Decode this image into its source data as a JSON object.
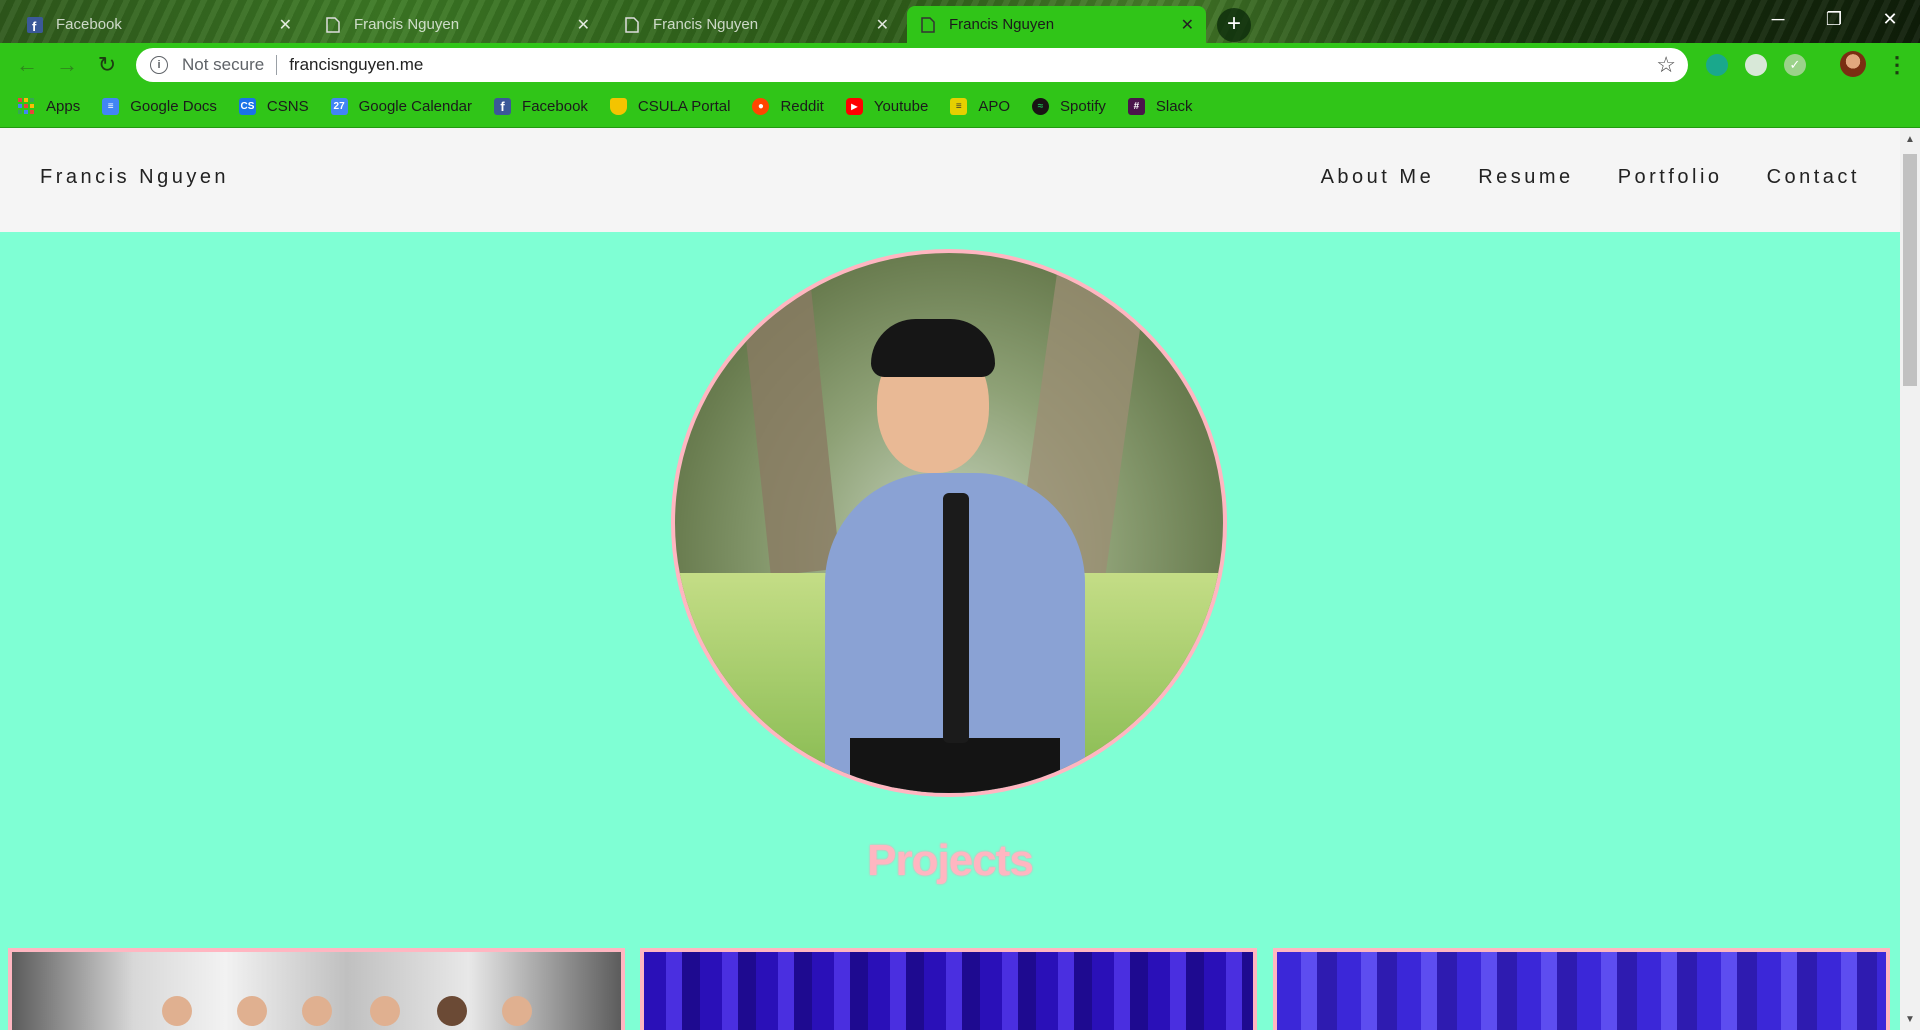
{
  "browser": {
    "tabs": [
      {
        "title": "Facebook",
        "icon": "facebook-icon",
        "active": false
      },
      {
        "title": "Francis Nguyen",
        "icon": "page-icon",
        "active": false
      },
      {
        "title": "Francis Nguyen",
        "icon": "page-icon",
        "active": false
      },
      {
        "title": "Francis Nguyen",
        "icon": "page-icon",
        "active": true
      }
    ],
    "new_tab": "+",
    "address": {
      "security": "Not secure",
      "url": "francisnguyen.me"
    },
    "bookmarks": [
      {
        "label": "Apps",
        "icon": "apps-grid-icon",
        "color": "#e8453c"
      },
      {
        "label": "Google Docs",
        "icon": "google-docs-icon",
        "color": "#4285f4"
      },
      {
        "label": "CSNS",
        "icon": "csns-icon",
        "color": "#1a73e8"
      },
      {
        "label": "Google Calendar",
        "icon": "calendar-icon",
        "color": "#4285f4"
      },
      {
        "label": "Facebook",
        "icon": "facebook-icon",
        "color": "#3b5998"
      },
      {
        "label": "CSULA Portal",
        "icon": "shield-icon",
        "color": "#f4c400"
      },
      {
        "label": "Reddit",
        "icon": "reddit-icon",
        "color": "#ff4500"
      },
      {
        "label": "Youtube",
        "icon": "youtube-icon",
        "color": "#ff0000"
      },
      {
        "label": "APO",
        "icon": "list-icon",
        "color": "#e6d000"
      },
      {
        "label": "Spotify",
        "icon": "spotify-icon",
        "color": "#191414"
      },
      {
        "label": "Slack",
        "icon": "slack-icon",
        "color": "#4a154b"
      }
    ]
  },
  "site": {
    "brand": "Francis Nguyen",
    "nav": [
      "About Me",
      "Resume",
      "Portfolio",
      "Contact"
    ],
    "section_title": "Projects"
  },
  "colors": {
    "page_bg": "#7fffd4",
    "accent_pink": "#ffb6c1",
    "chrome_green": "#30c518"
  }
}
